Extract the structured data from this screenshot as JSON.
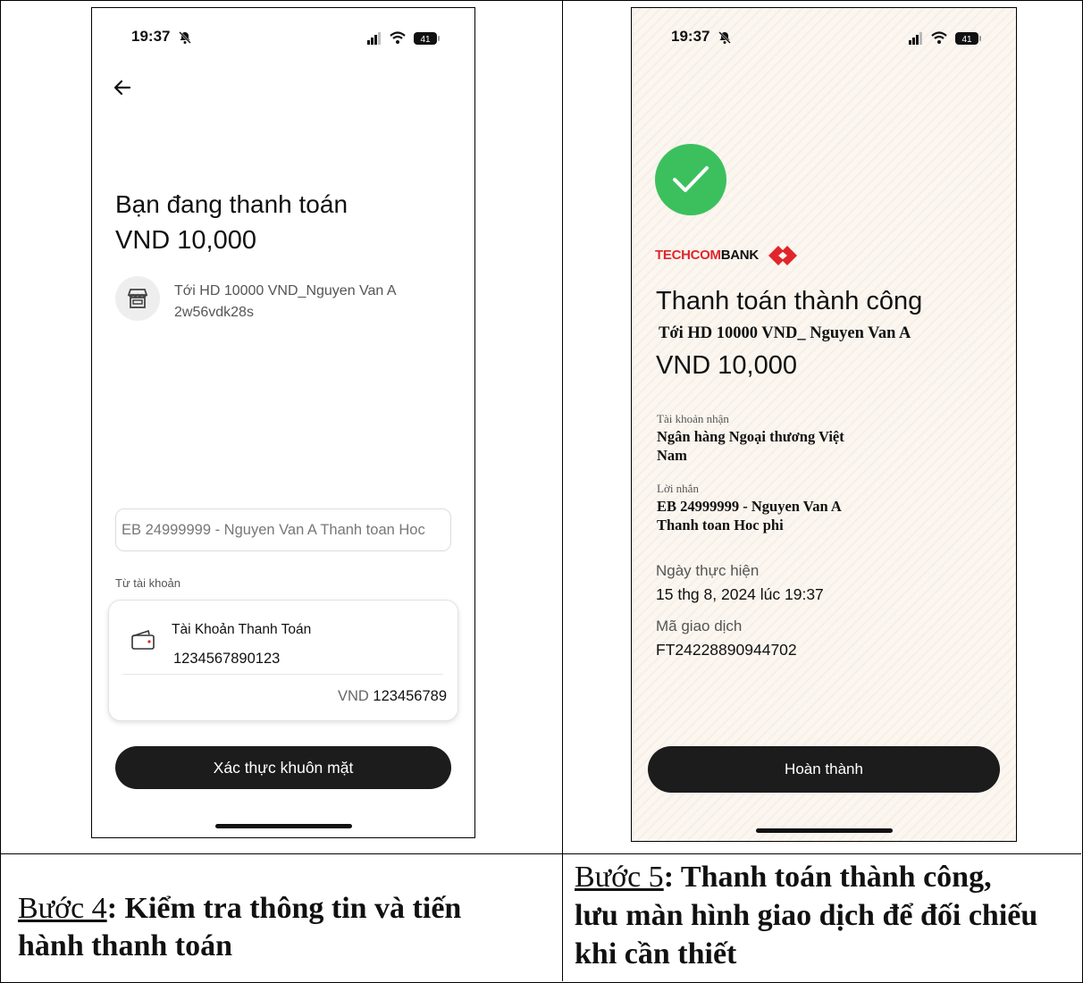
{
  "left_screen": {
    "status_time": "19:37",
    "battery": "41",
    "title_line1": "Bạn đang thanh toán",
    "amount": "VND 10,000",
    "recipient_line1": "Tới HD 10000 VND_Nguyen Van A",
    "recipient_line2": "2w56vdk28s",
    "message_value": "EB 24999999 - Nguyen Van A Thanh toan Hoc",
    "from_account_label": "Từ tài khoản",
    "account_name": "Tài Khoản Thanh Toán",
    "account_number": "1234567890123",
    "balance_currency": "VND",
    "balance_value": "123456789",
    "confirm_button": "Xác thực khuôn mặt"
  },
  "right_screen": {
    "status_time": "19:37",
    "battery": "41",
    "bank_logo_part1": "TECHCOM",
    "bank_logo_part2": "BANK",
    "success_title": "Thanh toán thành công",
    "recipient": "Tới HD 10000 VND_ Nguyen Van A",
    "amount": "VND 10,000",
    "receiving_account_label": "Tài khoản nhận",
    "receiving_account_line1": "Ngân hàng Ngoại thương Việt",
    "receiving_account_line2": "Nam",
    "message_label": "Lời nhắn",
    "message_line1": "EB 24999999 - Nguyen Van A",
    "message_line2": "Thanh toan Hoc phi",
    "date_label": "Ngày thực hiện",
    "date_value": "15 thg 8, 2024 lúc 19:37",
    "txn_label": "Mã giao dịch",
    "txn_value": "FT24228890944702",
    "done_button": "Hoàn thành"
  },
  "captions": {
    "step4_label": "Bước 4",
    "step4_text": ": Kiểm tra thông tin và tiến",
    "step4_text2": "hành thanh toán",
    "step5_label": "Bước 5",
    "step5_text": ": Thanh toán thành công,",
    "step5_text2": "lưu màn hình giao dịch để đối chiếu",
    "step5_text3": "khi cần thiết"
  },
  "colors": {
    "success_green": "#3cc05e",
    "techcombank_red": "#e0262b",
    "button_dark": "#1c1c1c"
  }
}
